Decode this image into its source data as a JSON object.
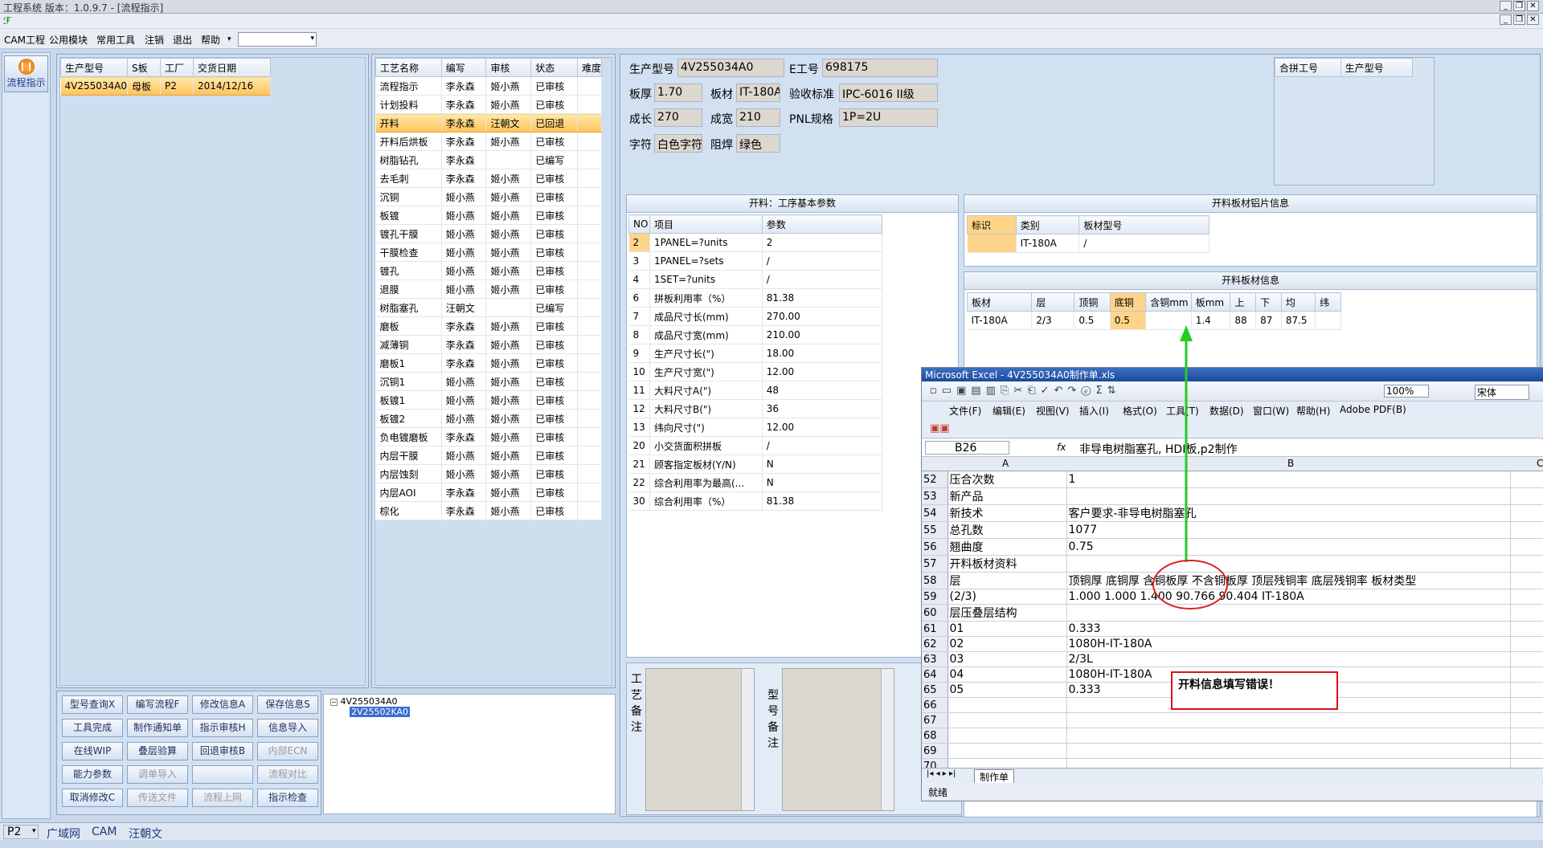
{
  "window": {
    "title": "工程系统   版本：1.0.9.7 - [流程指示]",
    "min": "_",
    "restore": "❐",
    "close": "✕"
  },
  "menu": [
    "CAM工程",
    "公用模块",
    "常用工具",
    "注销",
    "退出",
    "帮助"
  ],
  "menu_extra": "▾",
  "left_rail": {
    "flow_button": "流程指示"
  },
  "order_table": {
    "headers": [
      "生产型号",
      "S板",
      "工厂",
      "交货日期"
    ],
    "rows": [
      [
        "4V255034A0",
        "母板",
        "P2",
        "2014/12/16"
      ]
    ]
  },
  "process_table": {
    "headers": [
      "工艺名称",
      "编写",
      "审核",
      "状态",
      "难度"
    ],
    "rows": [
      [
        "流程指示",
        "李永森",
        "姬小燕",
        "已审核",
        ""
      ],
      [
        "计划投料",
        "李永森",
        "姬小燕",
        "已审核",
        ""
      ],
      [
        "开料",
        "李永森",
        "汪朝文",
        "已回退",
        ""
      ],
      [
        "开料后烘板",
        "李永森",
        "姬小燕",
        "已审核",
        ""
      ],
      [
        "树脂钻孔",
        "李永森",
        "",
        "已编写",
        ""
      ],
      [
        "去毛刺",
        "李永森",
        "姬小燕",
        "已审核",
        ""
      ],
      [
        "沉铜",
        "姬小燕",
        "姬小燕",
        "已审核",
        ""
      ],
      [
        "板镀",
        "姬小燕",
        "姬小燕",
        "已审核",
        ""
      ],
      [
        "镀孔干膜",
        "姬小燕",
        "姬小燕",
        "已审核",
        ""
      ],
      [
        "干膜检查",
        "姬小燕",
        "姬小燕",
        "已审核",
        ""
      ],
      [
        "镀孔",
        "姬小燕",
        "姬小燕",
        "已审核",
        ""
      ],
      [
        "退膜",
        "姬小燕",
        "姬小燕",
        "已审核",
        ""
      ],
      [
        "树脂塞孔",
        "汪朝文",
        "",
        "已编写",
        ""
      ],
      [
        "磨板",
        "李永森",
        "姬小燕",
        "已审核",
        ""
      ],
      [
        "减薄铜",
        "李永森",
        "姬小燕",
        "已审核",
        ""
      ],
      [
        "磨板1",
        "李永森",
        "姬小燕",
        "已审核",
        ""
      ],
      [
        "沉铜1",
        "姬小燕",
        "姬小燕",
        "已审核",
        ""
      ],
      [
        "板镀1",
        "姬小燕",
        "姬小燕",
        "已审核",
        ""
      ],
      [
        "板镀2",
        "姬小燕",
        "姬小燕",
        "已审核",
        ""
      ],
      [
        "负电镀磨板",
        "李永森",
        "姬小燕",
        "已审核",
        ""
      ],
      [
        "内层干膜",
        "姬小燕",
        "姬小燕",
        "已审核",
        ""
      ],
      [
        "内层蚀刻",
        "姬小燕",
        "姬小燕",
        "已审核",
        ""
      ],
      [
        "内层AOI",
        "李永森",
        "姬小燕",
        "已审核",
        ""
      ],
      [
        "棕化",
        "李永森",
        "姬小燕",
        "已审核",
        ""
      ]
    ],
    "selected_index": 2
  },
  "info": {
    "生产型号": "4V255034A0",
    "E工号": "698175",
    "板厚": "1.70",
    "板材": "IT-180A",
    "验收标准": "IPC-6016 II级",
    "成长": "270",
    "成宽": "210",
    "PNL规格": "1P=2U",
    "字符": "白色字符",
    "阻焊": "绿色"
  },
  "merge_table": {
    "headers": [
      "合拼工号",
      "生产型号"
    ]
  },
  "cut_params": {
    "title": "开料：工序基本参数",
    "headers": [
      "NO",
      "项目",
      "参数"
    ],
    "rows": [
      [
        "2",
        "1PANEL=?units",
        "2"
      ],
      [
        "3",
        "1PANEL=?sets",
        "/"
      ],
      [
        "4",
        "1SET=?units",
        "/"
      ],
      [
        "6",
        "拼板利用率（%）",
        "81.38"
      ],
      [
        "7",
        "成品尺寸长(mm)",
        "270.00"
      ],
      [
        "8",
        "成品尺寸宽(mm)",
        "210.00"
      ],
      [
        "9",
        "生产尺寸长(\")",
        "18.00"
      ],
      [
        "10",
        "生产尺寸宽(\")",
        "12.00"
      ],
      [
        "11",
        "大料尺寸A(\")",
        "48"
      ],
      [
        "12",
        "大料尺寸B(\")",
        "36"
      ],
      [
        "13",
        "纬向尺寸(\")",
        "12.00"
      ],
      [
        "20",
        "小交货面积拼板",
        "/"
      ],
      [
        "21",
        "顾客指定板材(Y/N)",
        "N"
      ],
      [
        "22",
        "综合利用率为最高(...",
        "N"
      ],
      [
        "30",
        "综合利用率（%）",
        "81.38"
      ]
    ]
  },
  "alu_info": {
    "title": "开料板材铝片信息",
    "headers": [
      "标识",
      "类别",
      "板材型号"
    ],
    "rows": [
      [
        "",
        "IT-180A",
        "/"
      ]
    ]
  },
  "board_info": {
    "title": "开料板材信息",
    "headers": [
      "板材",
      "层",
      "顶铜",
      "底铜",
      "含铜mm",
      "板mm",
      "上",
      "下",
      "均",
      "纬"
    ],
    "rows": [
      [
        "IT-180A",
        "2/3",
        "0.5",
        "0.5",
        "",
        "1.4",
        "88",
        "87",
        "87.5",
        ""
      ]
    ]
  },
  "remarks": {
    "process": "工艺备注",
    "model": "型号备注"
  },
  "buttons": [
    [
      "型号查询X",
      "编写流程F",
      "修改信息A",
      "保存信息S"
    ],
    [
      "工具完成",
      "制作通知单",
      "指示审核H",
      "信息导入"
    ],
    [
      "在线WIP",
      "叠层验算",
      "回退审核B",
      "内部ECN"
    ],
    [
      "能力参数",
      "调单导入",
      "",
      "流程对比"
    ],
    [
      "取消修改C",
      "传送文件",
      "流程上网",
      "指示检查"
    ]
  ],
  "disabled_buttons": [
    "内部ECN",
    "调单导入",
    "流程对比",
    "传送文件",
    "流程上网"
  ],
  "tree": {
    "root": "4V255034A0",
    "child": "2V25502KA0"
  },
  "excel": {
    "title": "Microsoft Excel - 4V255034A0制作单.xls",
    "menu": [
      "文件(F)",
      "编辑(E)",
      "视图(V)",
      "插入(I)",
      "格式(O)",
      "工具(T)",
      "数据(D)",
      "窗口(W)",
      "帮助(H)",
      "Adobe PDF(B)"
    ],
    "zoom": "100%",
    "font": "宋体",
    "cell_ref": "B26",
    "fx": "fx",
    "formula": "非导电树脂塞孔, HDI板,p2制作",
    "cols": [
      "A",
      "B",
      "C"
    ],
    "rows": [
      [
        "52",
        "压合次数",
        "1"
      ],
      [
        "53",
        "新产品",
        ""
      ],
      [
        "54",
        "新技术",
        "客户要求-非导电树脂塞孔"
      ],
      [
        "55",
        "总孔数",
        "1077"
      ],
      [
        "56",
        "翘曲度",
        "0.75"
      ],
      [
        "57",
        "开料板材资料",
        ""
      ],
      [
        "58",
        "层",
        "顶铜厚  底铜厚  含铜板厚  不含铜板厚  顶层残铜率  底层残铜率  板材类型"
      ],
      [
        "59",
        "(2/3)",
        "1.000   1.000    1.400                90.766     90.404      IT-180A"
      ],
      [
        "60",
        "层压叠层结构",
        ""
      ],
      [
        "61",
        "01",
        "0.333"
      ],
      [
        "62",
        "02",
        "1080H-IT-180A"
      ],
      [
        "63",
        "03",
        "2/3L"
      ],
      [
        "64",
        "04",
        "1080H-IT-180A"
      ],
      [
        "65",
        "05",
        "0.333"
      ],
      [
        "66",
        "",
        ""
      ],
      [
        "67",
        "",
        ""
      ],
      [
        "68",
        "",
        ""
      ],
      [
        "69",
        "",
        ""
      ],
      [
        "70",
        "",
        ""
      ]
    ],
    "sheet_tab": "制作单",
    "status": "就绪"
  },
  "annotation": {
    "text": "开料信息填写错误！",
    "arrow_color": "#22cc22",
    "circle_color": "#e02020"
  },
  "statusbar": {
    "factory": "P2",
    "items": [
      "广域网",
      "CAM",
      "汪朝文"
    ]
  }
}
